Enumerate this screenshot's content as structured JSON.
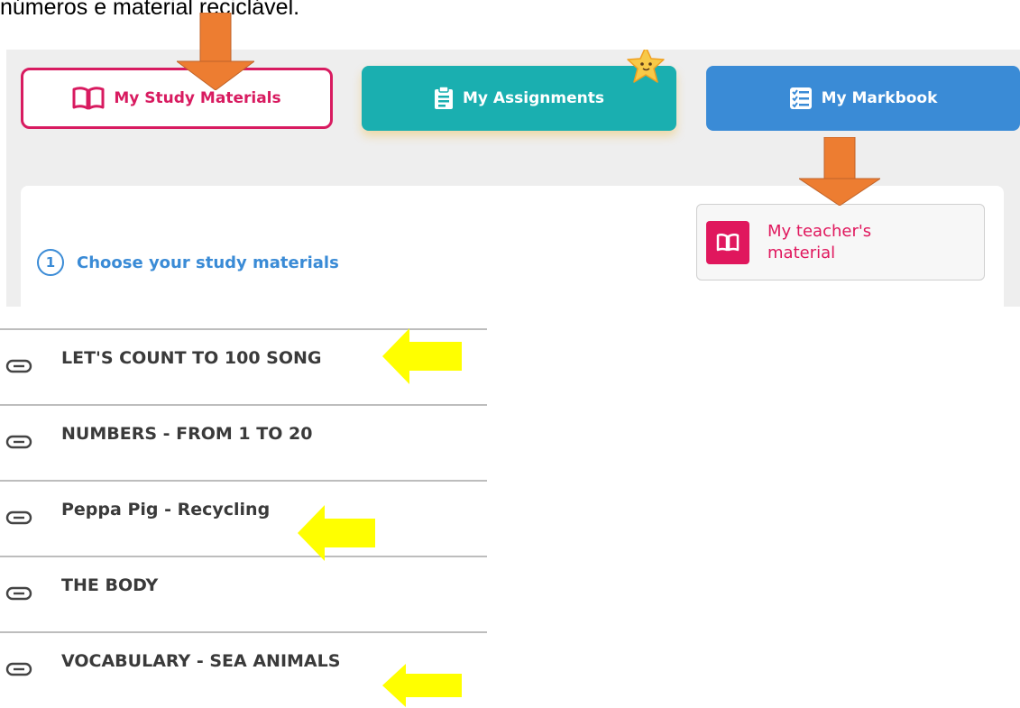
{
  "intro": {
    "text": "números e material reciclável."
  },
  "nav": {
    "study_label": "My Study Materials",
    "assignments_label": "My Assignments",
    "markbook_label": "My Markbook"
  },
  "card": {
    "step_number": "1",
    "step_label": "Choose your study materials",
    "teacher_label": "My teacher's material"
  },
  "materials": [
    {
      "label": "LET'S COUNT TO 100 SONG",
      "highlighted": true
    },
    {
      "label": "NUMBERS - FROM 1 TO 20",
      "highlighted": false
    },
    {
      "label": "Peppa Pig - Recycling",
      "highlighted": true
    },
    {
      "label": "THE BODY",
      "highlighted": false
    },
    {
      "label": "VOCABULARY - SEA ANIMALS",
      "highlighted": true
    }
  ],
  "colors": {
    "study_pink": "#d81b60",
    "assignments_teal": "#1aafb0",
    "markbook_blue": "#3a8bd6",
    "annotation_orange": "#ed7d31",
    "annotation_yellow": "#ffff00"
  }
}
